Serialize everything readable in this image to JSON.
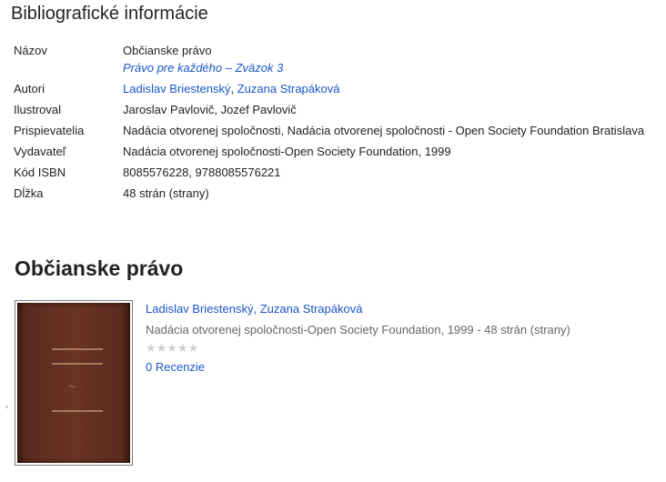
{
  "section_heading": "Bibliografické informácie",
  "bib_rows": {
    "title": {
      "label": "Názov",
      "value": "Občianske právo",
      "series_link": "Právo pre každého – Zväzok 3"
    },
    "authors": {
      "label": "Autori",
      "author1": "Ladislav Briestenský",
      "sep": ", ",
      "author2": "Zuzana Strapáková"
    },
    "illustrator": {
      "label": "Ilustroval",
      "value": "Jaroslav Pavlovič, Jozef Pavlovič"
    },
    "contributors": {
      "label": "Prispievatelia",
      "value": "Nadácia otvorenej spoločnosti, Nadácia otvorenej spoločnosti - Open Society Foundation Bratislava"
    },
    "publisher": {
      "label": "Vydavateľ",
      "value": "Nadácia otvorenej spoločnosti-Open Society Foundation, 1999"
    },
    "isbn": {
      "label": "Kód ISBN",
      "value": "8085576228, 9788085576221"
    },
    "length": {
      "label": "Dĺžka",
      "value": "48 strán (strany)"
    }
  },
  "book": {
    "title": "Občianske právo",
    "authors_link": "Ladislav Briestenský, Zuzana Strapáková",
    "publication": "Nadácia otvorenej spoločnosti-Open Society Foundation, 1999 - 48 strán (strany)",
    "rating_stars": "★★★★★",
    "rating_value": 0,
    "reviews_link": "0 Recenzie"
  },
  "colors": {
    "link": "#1a56c8",
    "muted": "#666666",
    "cover": "#5a2a1e"
  }
}
